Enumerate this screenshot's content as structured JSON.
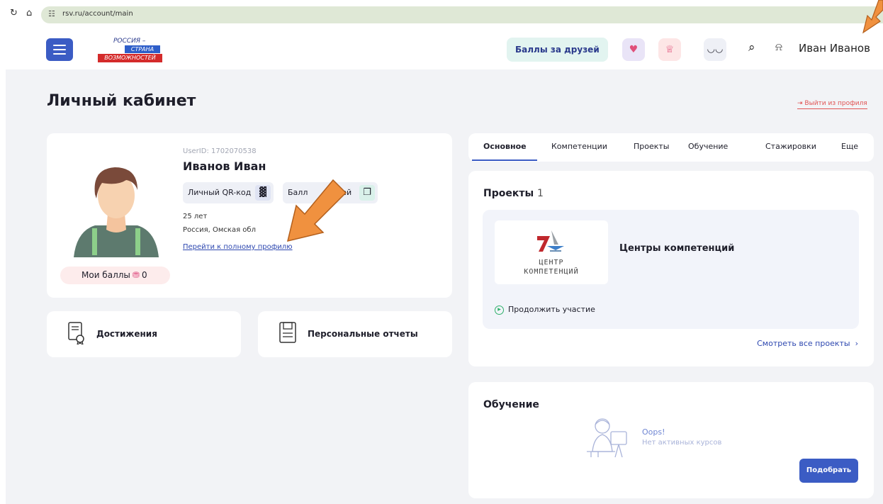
{
  "browser": {
    "reload_icon": "reload-icon",
    "home_icon": "home-icon",
    "site_settings_icon": "site-settings-icon",
    "url": "rsv.ru/account/main"
  },
  "header": {
    "menu_icon": "hamburger-menu-icon",
    "logo": {
      "line1": "РОССИЯ –",
      "line2": "СТРАНА",
      "line3": "ВОЗМОЖНОСТЕЙ"
    },
    "friends_points_label": "Баллы за друзей",
    "icons": [
      "handshake-heart-icon",
      "trophy-icon",
      "glasses-icon",
      "search-icon",
      "bell-icon"
    ],
    "user_name": "Иван Иванов"
  },
  "page": {
    "title": "Личный кабинет",
    "logout_label": "Выйти из профиля"
  },
  "profile": {
    "user_id": "UserID: 1702070538",
    "name": "Иванов Иван",
    "qr_label": "Личный QR-код",
    "friends_points_label": "Балл",
    "friends_points_label_tail": "зей",
    "age": "25 лет",
    "region": "Россия, Омская обл",
    "full_profile_link": "Перейти к полному профилю",
    "points_label": "Мои баллы",
    "points_value": "0"
  },
  "quick_links": {
    "achievements": "Достижения",
    "reports": "Персональные отчеты"
  },
  "tabs": [
    "Основное",
    "Компетенции",
    "Проекты",
    "Обучение",
    "Стажировки",
    "Еще"
  ],
  "active_tab": "Основное",
  "projects": {
    "title": "Проекты",
    "count": "1",
    "logo_line1": "ЦЕНТР",
    "logo_line2": "КОМПЕТЕНЦИЙ",
    "project_name": "Центры компетенций",
    "continue_label": "Продолжить участие",
    "see_all": "Смотреть все проекты"
  },
  "education": {
    "title": "Обучение",
    "empty_title": "Oops!",
    "empty_text": "Нет активных курсов",
    "pick_button": "Подобрать"
  },
  "colors": {
    "accent": "#3b5cc4",
    "link": "#2e48b0",
    "logout": "#e05454",
    "page_bg": "#f2f3f6",
    "annotation_arrow": "#f0913f"
  }
}
